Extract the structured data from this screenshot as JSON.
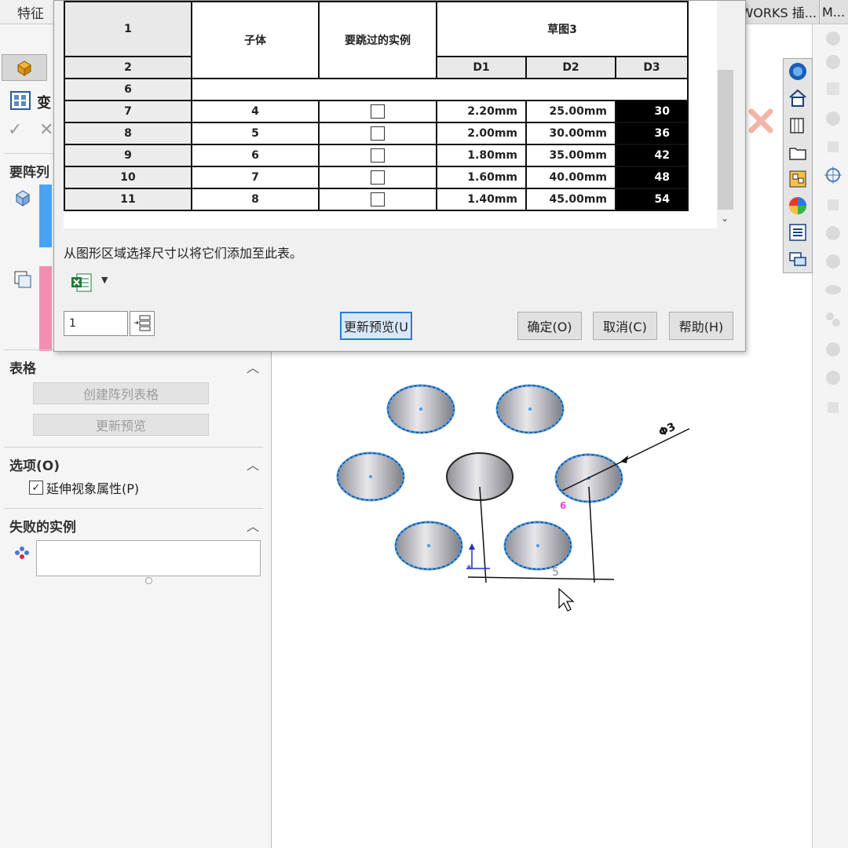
{
  "top_tabs": {
    "features": "特征",
    "addins": "DWORKS 插...",
    "m": "M..."
  },
  "left_panel": {
    "title": "变",
    "sections": {
      "pattern_label": "要阵列",
      "table_label": "表格",
      "create_table_button": "创建阵列表格",
      "update_preview_button": "更新预览",
      "options_label": "选项(O)",
      "propagate_checkbox": "延伸视象属性(P)",
      "failed_label": "失败的实例"
    }
  },
  "dialog": {
    "header": {
      "row1": "1",
      "row2": "2",
      "col_body": "子体",
      "col_skip": "要跳过的实例",
      "col_sketch": "草图3",
      "dims": [
        "D1",
        "D2",
        "D3"
      ]
    },
    "empty_row": "6",
    "rows": [
      {
        "n": "7",
        "body": "4",
        "d1": "2.20mm",
        "d2": "25.00mm",
        "d3": "30"
      },
      {
        "n": "8",
        "body": "5",
        "d1": "2.00mm",
        "d2": "30.00mm",
        "d3": "36"
      },
      {
        "n": "9",
        "body": "6",
        "d1": "1.80mm",
        "d2": "35.00mm",
        "d3": "42"
      },
      {
        "n": "10",
        "body": "7",
        "d1": "1.60mm",
        "d2": "40.00mm",
        "d3": "48"
      },
      {
        "n": "11",
        "body": "8",
        "d1": "1.40mm",
        "d2": "45.00mm",
        "d3": "54"
      }
    ],
    "hint": "从图形区域选择尺寸以将它们添加至此表。",
    "instance_input": "1",
    "buttons": {
      "update": "更新预览(U",
      "ok": "确定(O)",
      "cancel": "取消(C)",
      "help": "帮助(H)"
    }
  },
  "model": {
    "diameter_label": "Φ3",
    "spacing_label": "5",
    "pink_label": "6"
  }
}
